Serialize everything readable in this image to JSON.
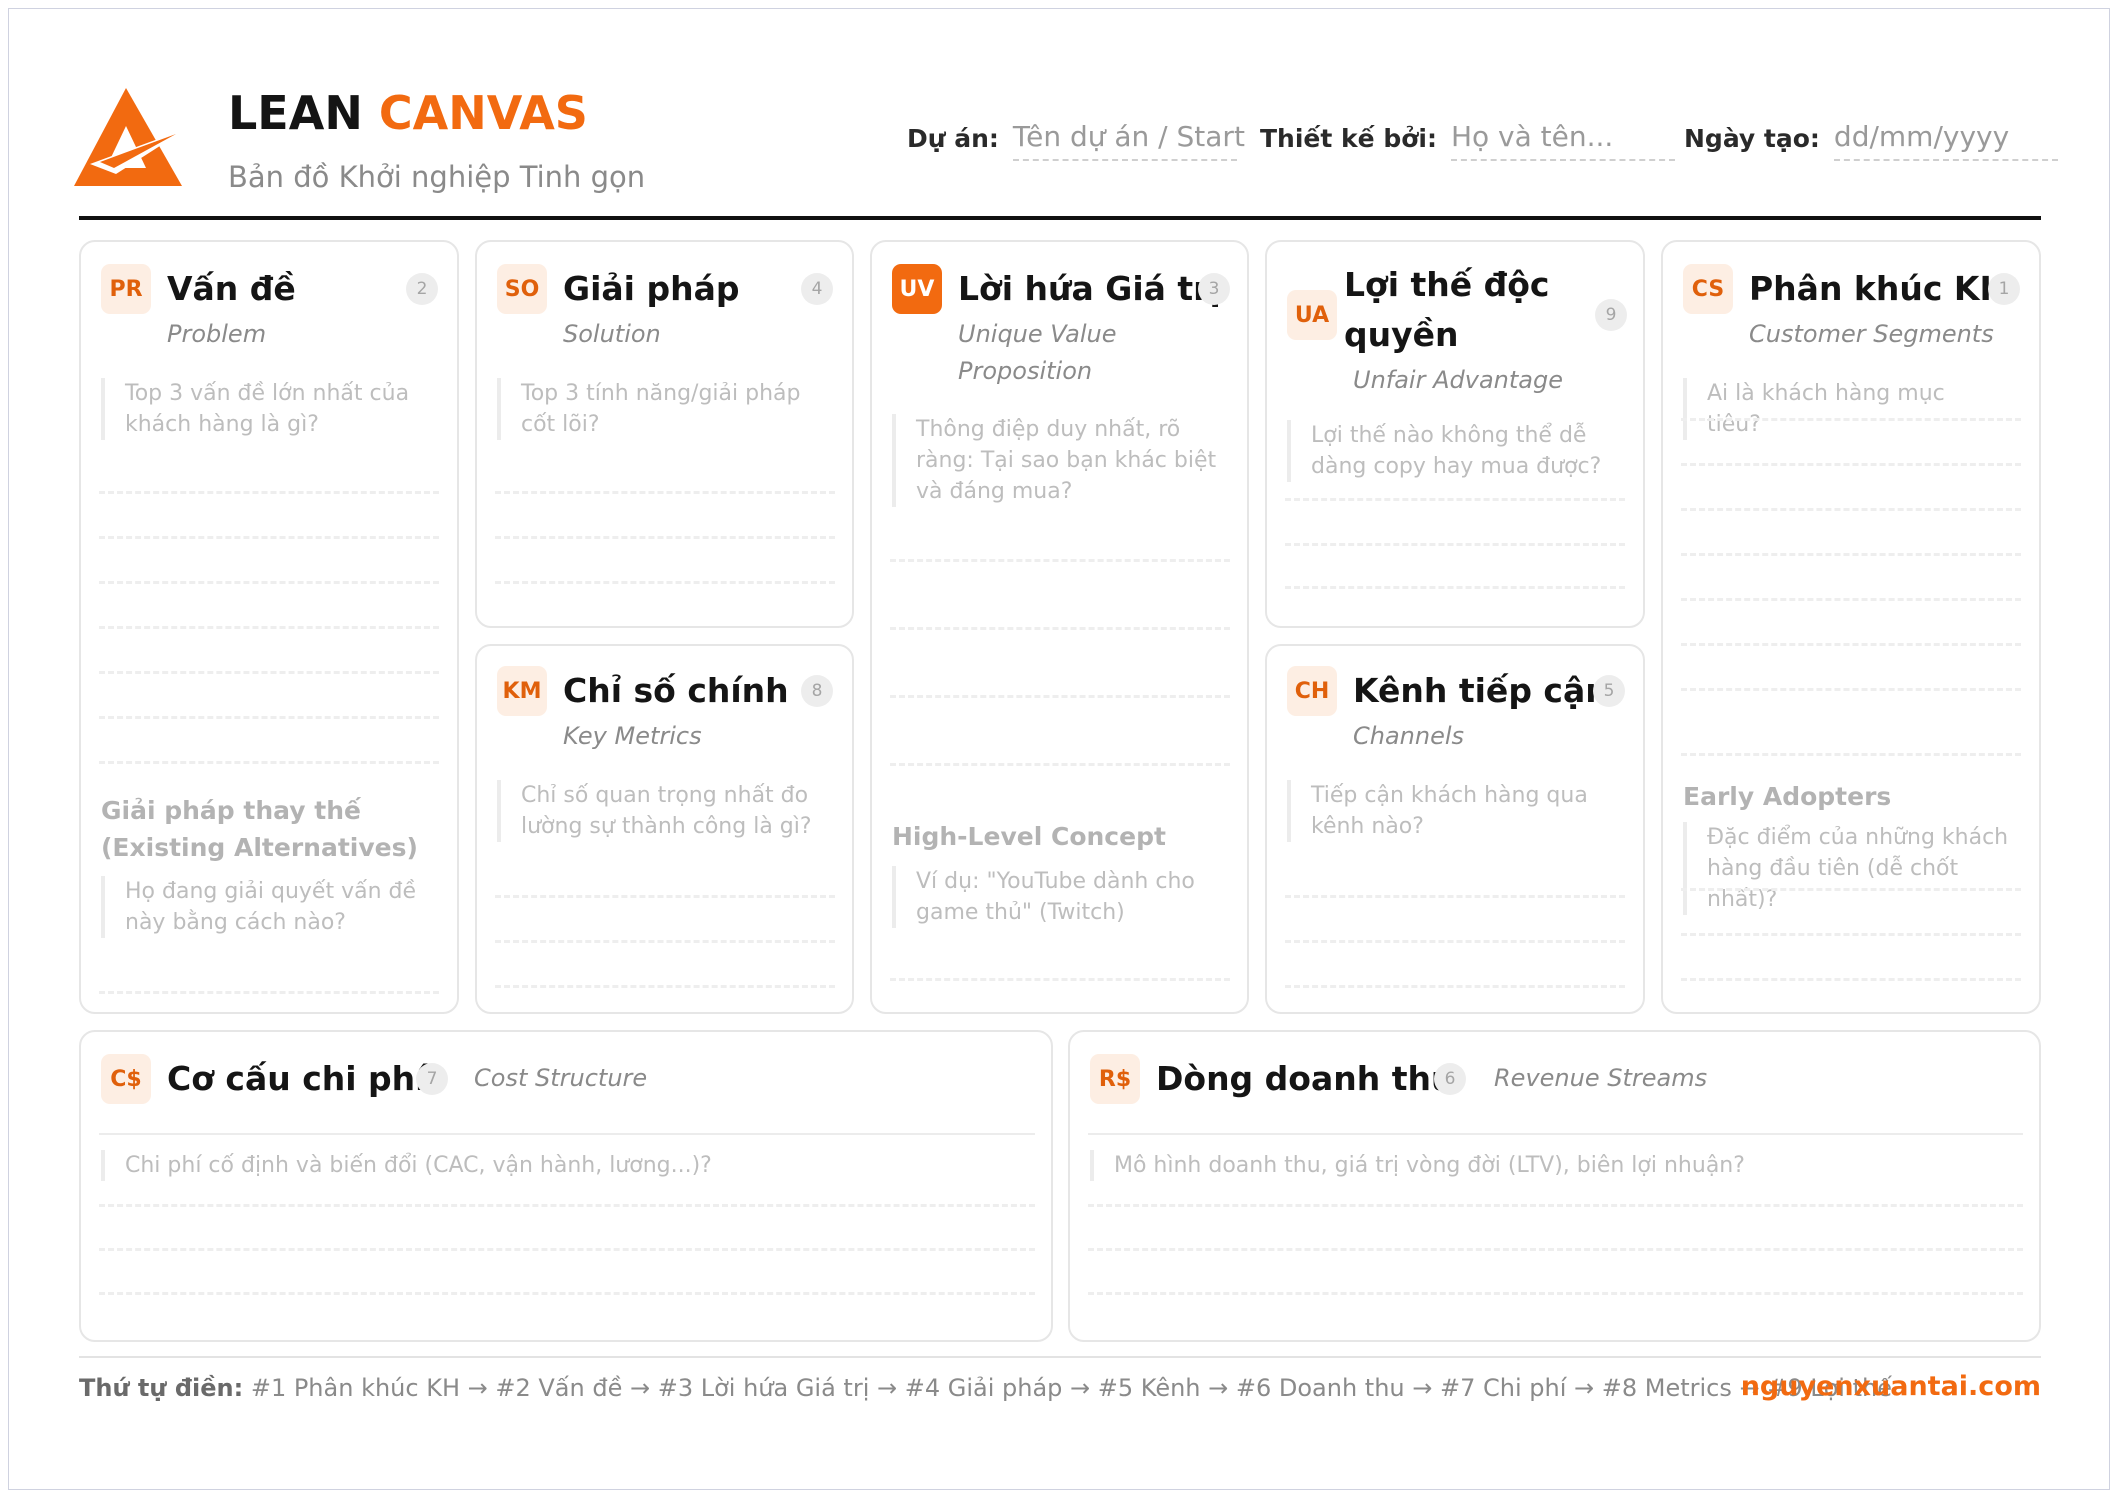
{
  "colors": {
    "accent": "#f26a10",
    "badge_bg": "#fdeee3"
  },
  "header": {
    "title_a": "LEAN",
    "title_b": "CANVAS",
    "tagline": "Bản đồ Khởi nghiệp Tinh gọn",
    "project_label": "Dự án:",
    "project_value": "Tên dự án / Start",
    "designer_label": "Thiết kế bởi:",
    "designer_value": "Họ và tên...",
    "date_label": "Ngày tạo:",
    "date_value": "dd/mm/yyyy"
  },
  "cards": {
    "problem": {
      "badge": "PR",
      "title": "Vấn đề",
      "num": "2",
      "subtitle": "Problem",
      "hint": "Top 3 vấn đề lớn nhất của khách hàng là gì?",
      "section": "Giải pháp thay thế (Existing Alternatives)",
      "section_hint": "Họ đang giải quyết vấn đề này bằng cách nào?"
    },
    "solution": {
      "badge": "SO",
      "title": "Giải pháp",
      "num": "4",
      "subtitle": "Solution",
      "hint": "Top 3 tính năng/giải pháp cốt lõi?"
    },
    "metrics": {
      "badge": "KM",
      "title": "Chỉ số chính",
      "num": "8",
      "subtitle": "Key Metrics",
      "hint": "Chỉ số quan trọng nhất đo lường sự thành công là gì?"
    },
    "uvp": {
      "badge": "UV",
      "title": "Lời hứa Giá trị",
      "num": "3",
      "subtitle": "Unique Value Proposition",
      "hint": "Thông điệp duy nhất, rõ ràng: Tại sao bạn khác biệt và đáng mua?",
      "section": "High-Level Concept",
      "section_hint": "Ví dụ: \"YouTube dành cho game thủ\" (Twitch)"
    },
    "unfair": {
      "badge": "UA",
      "title": "Lợi thế độc quyền",
      "num": "9",
      "subtitle": "Unfair Advantage",
      "hint": "Lợi thế nào không thể dễ dàng copy hay mua được?"
    },
    "channels": {
      "badge": "CH",
      "title": "Kênh tiếp cận",
      "num": "5",
      "subtitle": "Channels",
      "hint": "Tiếp cận khách hàng qua kênh nào?"
    },
    "segments": {
      "badge": "CS",
      "title": "Phân khúc KH",
      "num": "1",
      "subtitle": "Customer Segments",
      "hint": "Ai là khách hàng mục tiêu?",
      "section": "Early Adopters",
      "section_hint": "Đặc điểm của những khách hàng đầu tiên (dễ chốt nhất)?"
    },
    "cost": {
      "badge": "C$",
      "title": "Cơ cấu chi phí",
      "num": "7",
      "subtitle": "Cost Structure",
      "hint": "Chi phí cố định và biến đổi (CAC, vận hành, lương...)?"
    },
    "revenue": {
      "badge": "R$",
      "title": "Dòng doanh thu",
      "num": "6",
      "subtitle": "Revenue Streams",
      "hint": "Mô hình doanh thu, giá trị vòng đời (LTV), biên lợi nhuận?"
    }
  },
  "footer": {
    "label": "Thứ tự điền:",
    "sequence": "#1 Phân khúc KH → #2 Vấn đề → #3 Lời hứa Giá trị → #4 Giải pháp → #5 Kênh → #6 Doanh thu → #7 Chi phí → #8 Metrics → #9 Lợi thế",
    "site": "nguyenxuantai.com"
  }
}
